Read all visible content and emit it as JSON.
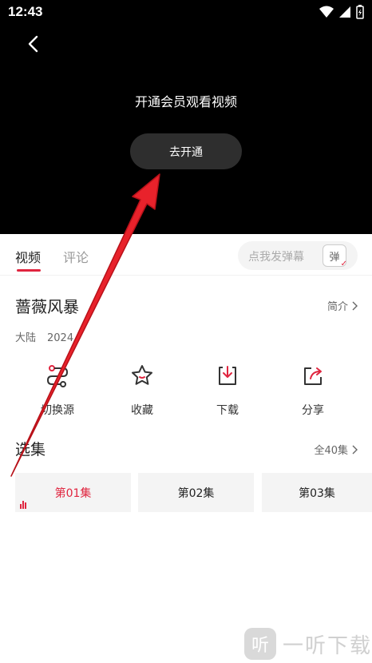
{
  "status_bar": {
    "time": "12:43"
  },
  "player": {
    "prompt": "开通会员观看视频",
    "button_label": "去开通"
  },
  "tabs": [
    {
      "label": "视频",
      "active": true
    },
    {
      "label": "评论",
      "active": false
    }
  ],
  "danmu": {
    "placeholder": "点我发弹幕",
    "toggle_label": "弹"
  },
  "show": {
    "title": "蔷薇风暴",
    "intro_link": "简介",
    "region": "大陆",
    "year": "2024"
  },
  "actions": [
    {
      "label": "切换源",
      "icon": "switch-source-icon"
    },
    {
      "label": "收藏",
      "icon": "star-icon"
    },
    {
      "label": "下载",
      "icon": "download-icon"
    },
    {
      "label": "分享",
      "icon": "share-icon"
    }
  ],
  "episodes": {
    "title": "选集",
    "all_label": "全40集",
    "items": [
      {
        "label": "第01集",
        "active": true
      },
      {
        "label": "第02集",
        "active": false
      },
      {
        "label": "第03集",
        "active": false
      }
    ]
  },
  "watermark": {
    "text": "一听下载",
    "glyph": "听"
  },
  "colors": {
    "accent": "#e0253f",
    "player_bg": "#000000",
    "annotation_arrow": "#e8222b"
  }
}
